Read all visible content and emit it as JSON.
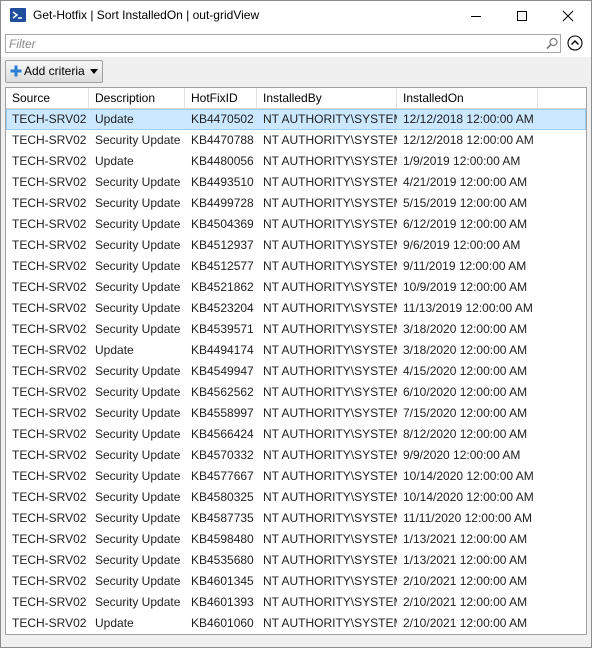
{
  "window": {
    "title": "Get-Hotfix | Sort InstalledOn | out-gridView"
  },
  "filter": {
    "placeholder": "Filter"
  },
  "criteria": {
    "button_label": "Add criteria"
  },
  "table": {
    "columns": [
      "Source",
      "Description",
      "HotFixID",
      "InstalledBy",
      "InstalledOn"
    ],
    "rows": [
      [
        "TECH-SRV02",
        "Update",
        "KB4470502",
        "NT AUTHORITY\\SYSTEM",
        "12/12/2018 12:00:00 AM"
      ],
      [
        "TECH-SRV02",
        "Security Update",
        "KB4470788",
        "NT AUTHORITY\\SYSTEM",
        "12/12/2018 12:00:00 AM"
      ],
      [
        "TECH-SRV02",
        "Update",
        "KB4480056",
        "NT AUTHORITY\\SYSTEM",
        "1/9/2019 12:00:00 AM"
      ],
      [
        "TECH-SRV02",
        "Security Update",
        "KB4493510",
        "NT AUTHORITY\\SYSTEM",
        "4/21/2019 12:00:00 AM"
      ],
      [
        "TECH-SRV02",
        "Security Update",
        "KB4499728",
        "NT AUTHORITY\\SYSTEM",
        "5/15/2019 12:00:00 AM"
      ],
      [
        "TECH-SRV02",
        "Security Update",
        "KB4504369",
        "NT AUTHORITY\\SYSTEM",
        "6/12/2019 12:00:00 AM"
      ],
      [
        "TECH-SRV02",
        "Security Update",
        "KB4512937",
        "NT AUTHORITY\\SYSTEM",
        "9/6/2019 12:00:00 AM"
      ],
      [
        "TECH-SRV02",
        "Security Update",
        "KB4512577",
        "NT AUTHORITY\\SYSTEM",
        "9/11/2019 12:00:00 AM"
      ],
      [
        "TECH-SRV02",
        "Security Update",
        "KB4521862",
        "NT AUTHORITY\\SYSTEM",
        "10/9/2019 12:00:00 AM"
      ],
      [
        "TECH-SRV02",
        "Security Update",
        "KB4523204",
        "NT AUTHORITY\\SYSTEM",
        "11/13/2019 12:00:00 AM"
      ],
      [
        "TECH-SRV02",
        "Security Update",
        "KB4539571",
        "NT AUTHORITY\\SYSTEM",
        "3/18/2020 12:00:00 AM"
      ],
      [
        "TECH-SRV02",
        "Update",
        "KB4494174",
        "NT AUTHORITY\\SYSTEM",
        "3/18/2020 12:00:00 AM"
      ],
      [
        "TECH-SRV02",
        "Security Update",
        "KB4549947",
        "NT AUTHORITY\\SYSTEM",
        "4/15/2020 12:00:00 AM"
      ],
      [
        "TECH-SRV02",
        "Security Update",
        "KB4562562",
        "NT AUTHORITY\\SYSTEM",
        "6/10/2020 12:00:00 AM"
      ],
      [
        "TECH-SRV02",
        "Security Update",
        "KB4558997",
        "NT AUTHORITY\\SYSTEM",
        "7/15/2020 12:00:00 AM"
      ],
      [
        "TECH-SRV02",
        "Security Update",
        "KB4566424",
        "NT AUTHORITY\\SYSTEM",
        "8/12/2020 12:00:00 AM"
      ],
      [
        "TECH-SRV02",
        "Security Update",
        "KB4570332",
        "NT AUTHORITY\\SYSTEM",
        "9/9/2020 12:00:00 AM"
      ],
      [
        "TECH-SRV02",
        "Security Update",
        "KB4577667",
        "NT AUTHORITY\\SYSTEM",
        "10/14/2020 12:00:00 AM"
      ],
      [
        "TECH-SRV02",
        "Security Update",
        "KB4580325",
        "NT AUTHORITY\\SYSTEM",
        "10/14/2020 12:00:00 AM"
      ],
      [
        "TECH-SRV02",
        "Security Update",
        "KB4587735",
        "NT AUTHORITY\\SYSTEM",
        "11/11/2020 12:00:00 AM"
      ],
      [
        "TECH-SRV02",
        "Security Update",
        "KB4598480",
        "NT AUTHORITY\\SYSTEM",
        "1/13/2021 12:00:00 AM"
      ],
      [
        "TECH-SRV02",
        "Security Update",
        "KB4535680",
        "NT AUTHORITY\\SYSTEM",
        "1/13/2021 12:00:00 AM"
      ],
      [
        "TECH-SRV02",
        "Security Update",
        "KB4601345",
        "NT AUTHORITY\\SYSTEM",
        "2/10/2021 12:00:00 AM"
      ],
      [
        "TECH-SRV02",
        "Security Update",
        "KB4601393",
        "NT AUTHORITY\\SYSTEM",
        "2/10/2021 12:00:00 AM"
      ],
      [
        "TECH-SRV02",
        "Update",
        "KB4601060",
        "NT AUTHORITY\\SYSTEM",
        "2/10/2021 12:00:00 AM"
      ]
    ]
  },
  "colors": {
    "selected_row": "#cce8ff",
    "selected_border": "#99d1ff",
    "app_icon": "#1f4e9c",
    "plus_icon": "#2a7fd4"
  },
  "icons": {
    "app": "powershell-icon",
    "minimize": "minimize-icon",
    "maximize": "maximize-icon",
    "close": "close-icon",
    "search": "search-icon",
    "collapse": "chevron-up-circle-icon",
    "add": "plus-icon",
    "dropdown": "caret-down-icon"
  }
}
